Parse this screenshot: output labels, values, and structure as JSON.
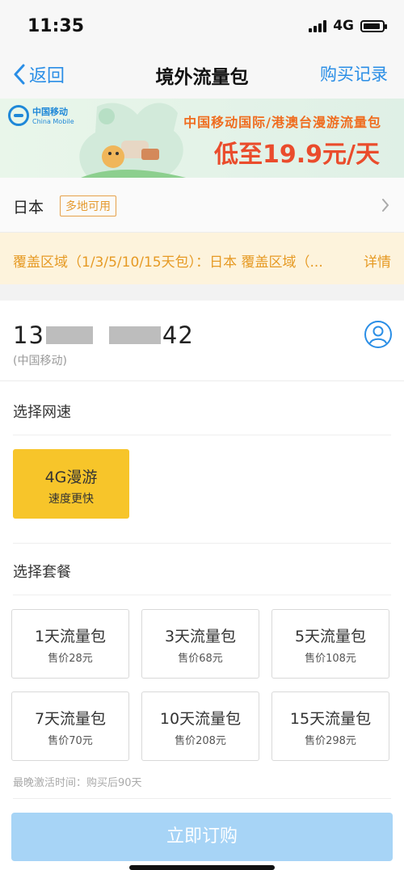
{
  "status_bar": {
    "time": "11:35",
    "network": "4G"
  },
  "nav": {
    "back_label": "返回",
    "title": "境外流量包",
    "right_label": "购买记录"
  },
  "banner": {
    "brand_cn": "中国移动",
    "brand_en": "China Mobile",
    "headline": "中国移动国际/港澳台漫游流量包",
    "price_line": "低至19.9元/天"
  },
  "destination": {
    "country": "日本",
    "tag": "多地可用"
  },
  "notice": {
    "text": "覆盖区域（1/3/5/10/15天包）：日本 覆盖区域（...",
    "link": "详情"
  },
  "account": {
    "phone_prefix": "13",
    "phone_suffix": "42",
    "carrier": "(中国移动)"
  },
  "speed_section": {
    "title": "选择网速",
    "option_title": "4G漫游",
    "option_sub": "速度更快"
  },
  "package_section": {
    "title": "选择套餐",
    "packages": [
      {
        "title": "1天流量包",
        "price": "售价28元"
      },
      {
        "title": "3天流量包",
        "price": "售价68元"
      },
      {
        "title": "5天流量包",
        "price": "售价108元"
      },
      {
        "title": "7天流量包",
        "price": "售价70元"
      },
      {
        "title": "10天流量包",
        "price": "售价208元"
      },
      {
        "title": "15天流量包",
        "price": "售价298元"
      }
    ]
  },
  "activation_note": "最晚激活时间：购买后90天",
  "buy_button": "立即订购",
  "colors": {
    "accent": "#2a8ee6",
    "selected": "#f7c52a",
    "button_disabled": "#a7d4f6",
    "notice": "#e69a24"
  }
}
